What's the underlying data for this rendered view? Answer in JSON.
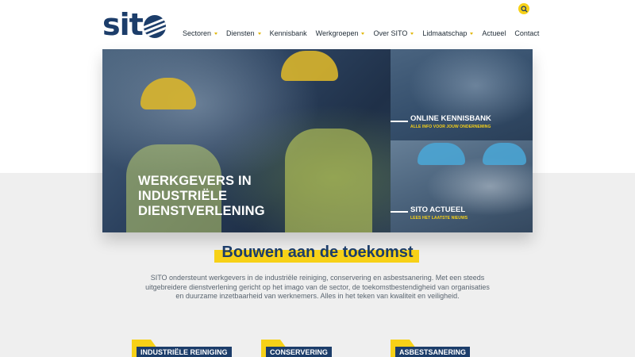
{
  "brand": {
    "logo_text": "sit",
    "logo_icon": "globe-o-icon"
  },
  "header": {
    "search_icon": "search-icon",
    "nav": [
      {
        "label": "Sectoren",
        "dropdown": true
      },
      {
        "label": "Diensten",
        "dropdown": true
      },
      {
        "label": "Kennisbank",
        "dropdown": false
      },
      {
        "label": "Werkgroepen",
        "dropdown": true
      },
      {
        "label": "Over SITO",
        "dropdown": true
      },
      {
        "label": "Lidmaatschap",
        "dropdown": true
      },
      {
        "label": "Actueel",
        "dropdown": false
      },
      {
        "label": "Contact",
        "dropdown": false
      }
    ]
  },
  "hero": {
    "title": "WERKGEVERS IN INDUSTRIËLE DIENSTVERLENING",
    "tiles": [
      {
        "title": "ONLINE KENNISBANK",
        "subtitle": "ALLE INFO VOOR JOUW ONDERNEMING"
      },
      {
        "title": "SITO ACTUEEL",
        "subtitle": "LEES HET LAATSTE NIEUWS"
      }
    ]
  },
  "intro": {
    "headline": "Bouwen aan de toekomst",
    "text": "SITO ondersteunt werkgevers in de industriële reiniging, conservering en asbestsanering. Met een steeds uitgebreidere dienstverlening gericht op het imago van de sector, de toekomstbestendigheid van organisaties en duurzame inzetbaarheid van werknemers. Alles in het teken van kwaliteit en veiligheid."
  },
  "sectors": [
    {
      "label": "INDUSTRIËLE REINIGING"
    },
    {
      "label": "CONSERVERING"
    },
    {
      "label": "ASBESTSANERING"
    }
  ],
  "colors": {
    "brand_blue": "#1c3d6a",
    "accent_yellow": "#f7d117",
    "background_grey": "#efefef"
  }
}
